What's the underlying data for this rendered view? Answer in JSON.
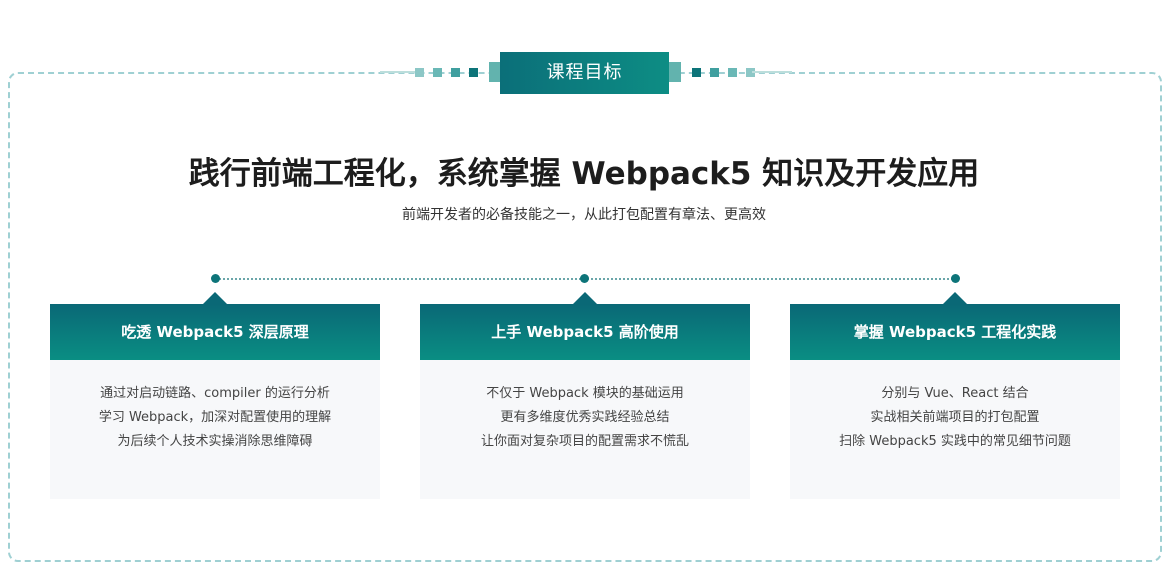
{
  "header": {
    "badge_label": "课程目标",
    "accent_dark": "#0b6f79",
    "accent_light": "#0d8d84"
  },
  "hero": {
    "title": "践行前端工程化，系统掌握 Webpack5 知识及开发应用",
    "subtitle": "前端开发者的必备技能之一，从此打包配置有章法、更高效"
  },
  "cards": [
    {
      "title": "吃透 Webpack5 深层原理",
      "lines": [
        "通过对启动链路、compiler 的运行分析",
        "学习 Webpack，加深对配置使用的理解",
        "为后续个人技术实操消除思维障碍"
      ]
    },
    {
      "title": "上手 Webpack5 高阶使用",
      "lines": [
        "不仅于 Webpack 模块的基础运用",
        "更有多维度优秀实践经验总结",
        "让你面对复杂项目的配置需求不慌乱"
      ]
    },
    {
      "title": "掌握 Webpack5 工程化实践",
      "lines": [
        "分别与 Vue、React 结合",
        "实战相关前端项目的打包配置",
        "扫除 Webpack5 实践中的常见细节问题"
      ]
    }
  ]
}
